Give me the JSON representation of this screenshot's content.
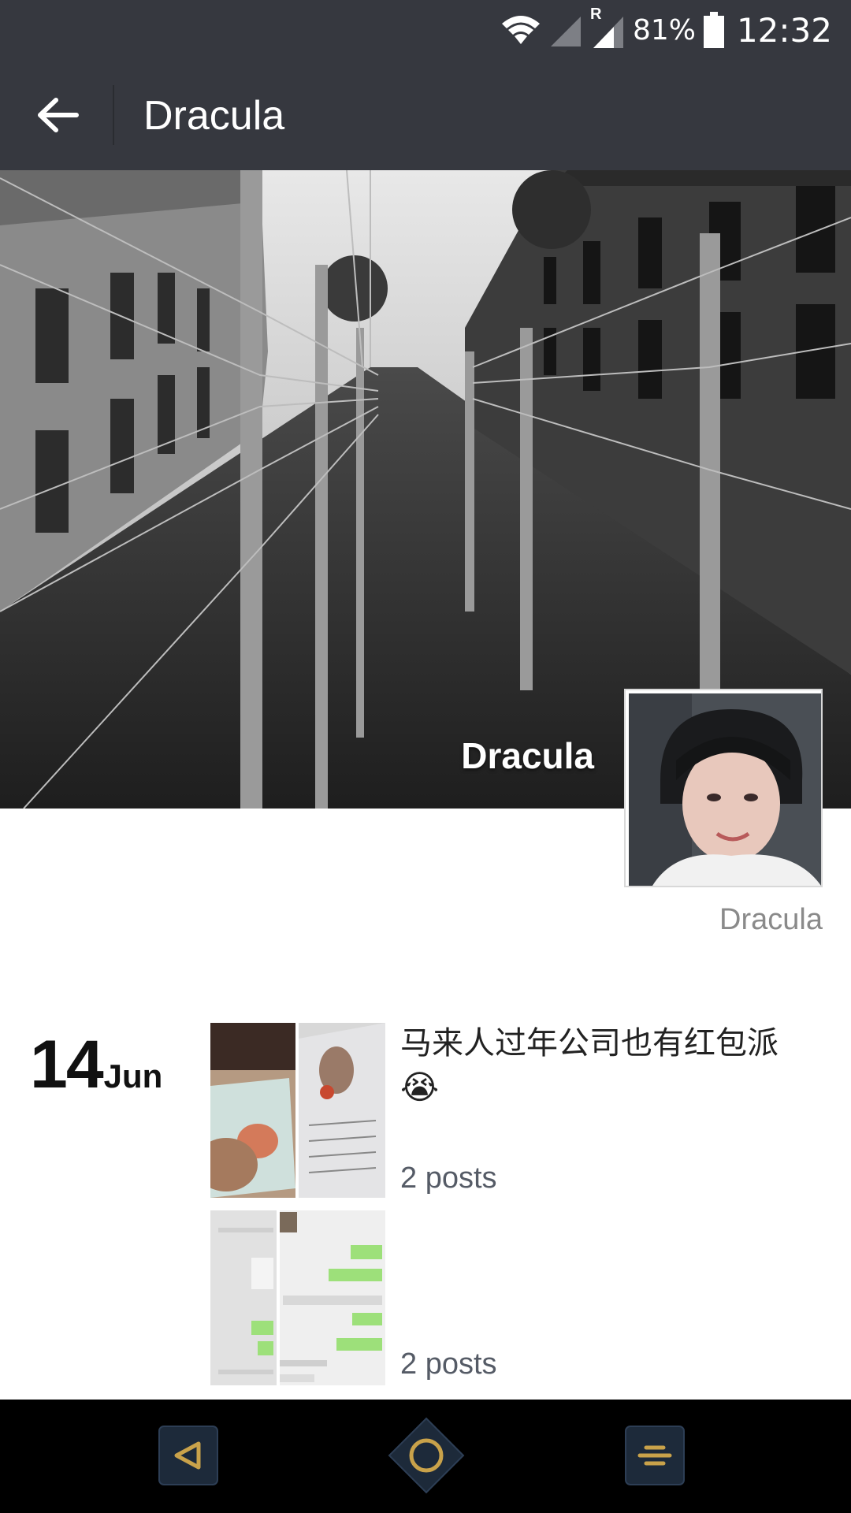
{
  "status_bar": {
    "battery_percent": "81%",
    "time": "12:32",
    "icons": [
      "wifi-icon",
      "signal-icon",
      "roaming-signal-icon",
      "battery-icon"
    ],
    "roaming_letter": "R"
  },
  "header": {
    "title": "Dracula",
    "back_icon": "arrow-left-icon"
  },
  "profile": {
    "cover_name": "Dracula",
    "sub_name": "Dracula"
  },
  "timeline": {
    "day": "14",
    "month": "Jun",
    "post_caption": "马来人过年公司也有红包派",
    "emoji": "😭",
    "posts_count_1": "2 posts",
    "posts_count_2": "2 posts"
  },
  "nav_bar": {
    "icons": [
      "back-triangle-icon",
      "home-circle-icon",
      "recents-menu-icon"
    ],
    "accent_color": "#c9a24a"
  }
}
